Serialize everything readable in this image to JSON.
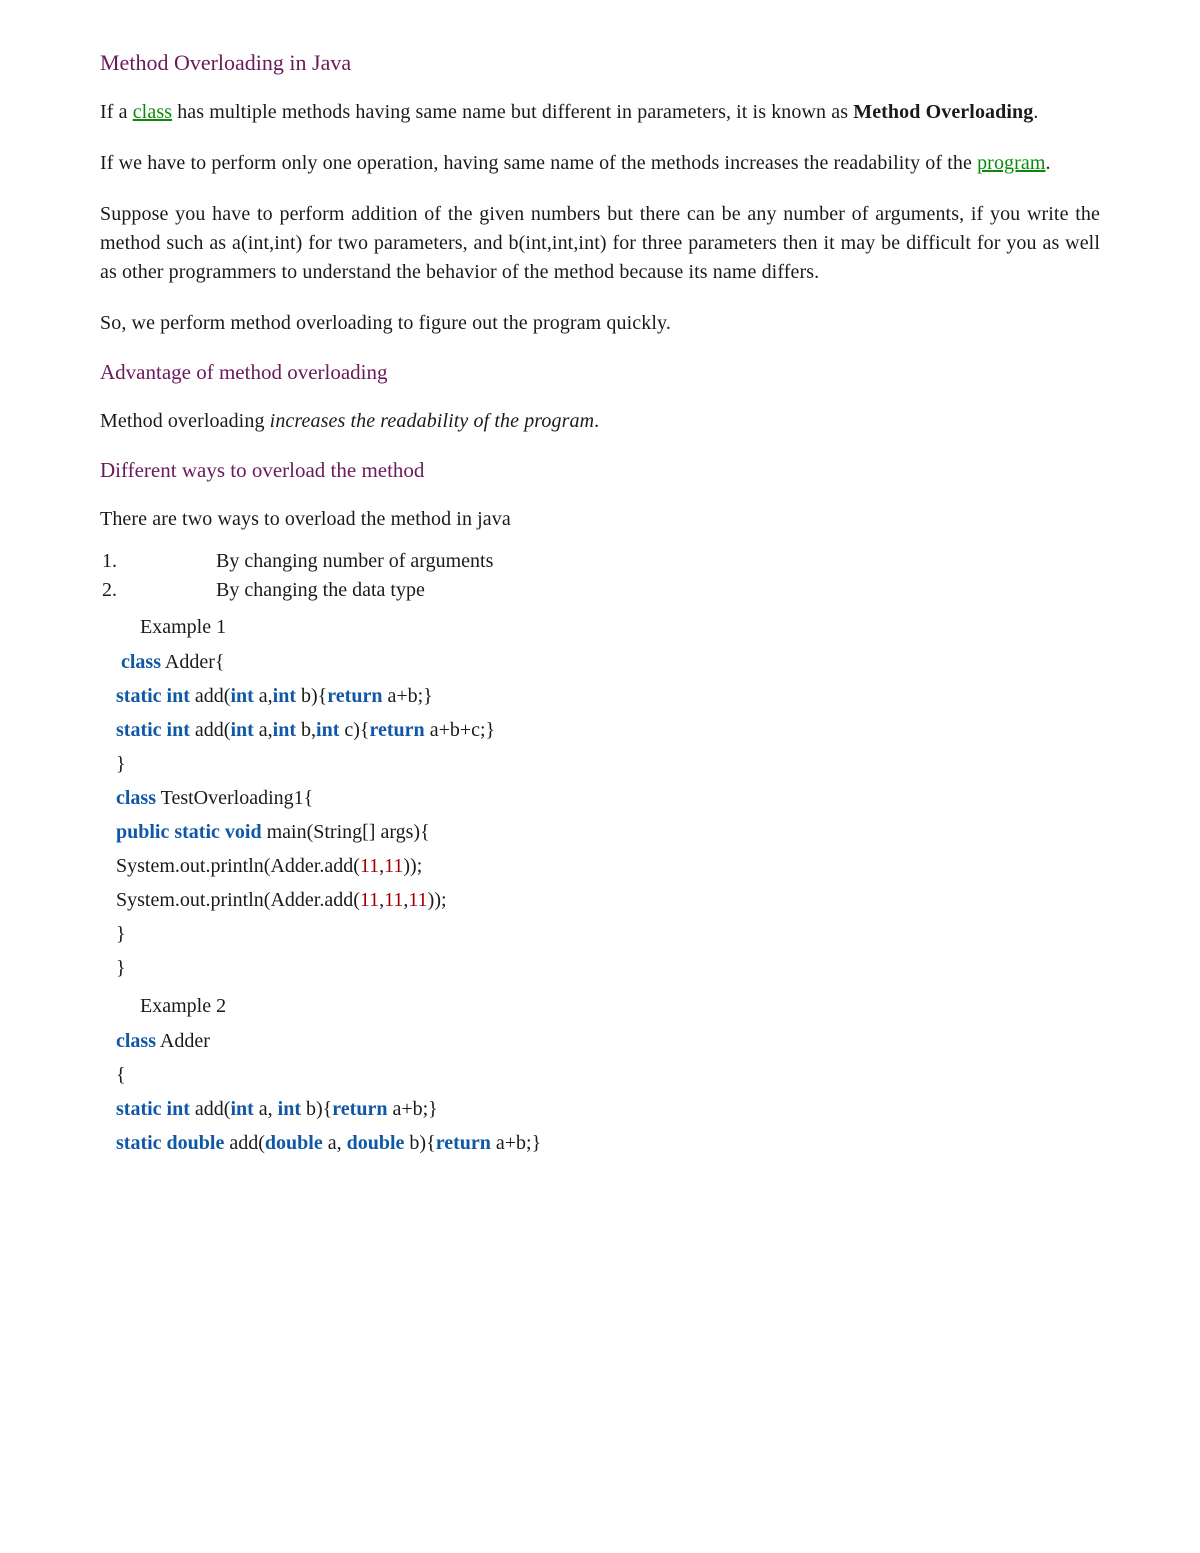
{
  "title": "Method Overloading in Java",
  "para1": {
    "pre": "If a ",
    "link": "class",
    "mid": " has multiple methods having same name but different in parameters, it is known as ",
    "bold": "Method Overloading",
    "post": "."
  },
  "para2": {
    "pre": "If we have to perform only one operation, having same name of the methods increases the readability of the ",
    "link": "program",
    "post": "."
  },
  "para3": "Suppose you have to perform addition of the given numbers but there can be any number of arguments, if you write the method such as a(int,int) for two parameters, and b(int,int,int) for three parameters then it may be difficult for you as well as other programmers to understand the behavior of the method because its name differs.",
  "para4": "So, we perform method overloading to figure out the program quickly.",
  "heading_advantage": "Advantage of method overloading",
  "para_advantage": {
    "pre": "Method overloading ",
    "italic": "increases the readability of the program",
    "post": "."
  },
  "heading_ways": "Different ways to overload the method",
  "para_ways_intro": "There are two ways to overload the method in java",
  "ways": {
    "w1": "By changing number of arguments",
    "w2": "By changing the data type"
  },
  "example1_label": "Example 1",
  "example2_label": "Example 2",
  "code1": {
    "t01": " class",
    "t02": " Adder{",
    "t03": "static",
    "t04": "int",
    "t05": " add(",
    "t06": "int",
    "t07": " a,",
    "t08": "int",
    "t09": " b){",
    "t10": "return",
    "t11": " a+b;}",
    "t12": "static",
    "t13": "int",
    "t14": " add(",
    "t15": "int",
    "t16": " a,",
    "t17": "int",
    "t18": " b,",
    "t19": "int",
    "t20": " c){",
    "t21": "return",
    "t22": " a+b+c;}",
    "t23": "}",
    "t24": "class",
    "t25": " TestOverloading1{",
    "t26": "public",
    "t27": "static",
    "t28": "void",
    "t29": " main(String[] args){",
    "t30": "System.out.println(Adder.add(",
    "t31": "11",
    "t32": ",",
    "t33": "11",
    "t34": "));",
    "t35": "System.out.println(Adder.add(",
    "t36": "11",
    "t37": ",",
    "t38": "11",
    "t39": ",",
    "t40": "11",
    "t41": "));",
    "t42": "}",
    "t43": "}"
  },
  "code2": {
    "t01": "class",
    "t02": " Adder",
    "t03": "{",
    "t04": "static",
    "t05": "int",
    "t06": " add(",
    "t07": "int",
    "t08": " a, ",
    "t09": "int",
    "t10": " b){",
    "t11": "return",
    "t12": " a+b;}",
    "t13": "static",
    "t14": "double",
    "t15": " add(",
    "t16": "double",
    "t17": " a, ",
    "t18": "double",
    "t19": " b){",
    "t20": "return",
    "t21": " a+b;}"
  }
}
